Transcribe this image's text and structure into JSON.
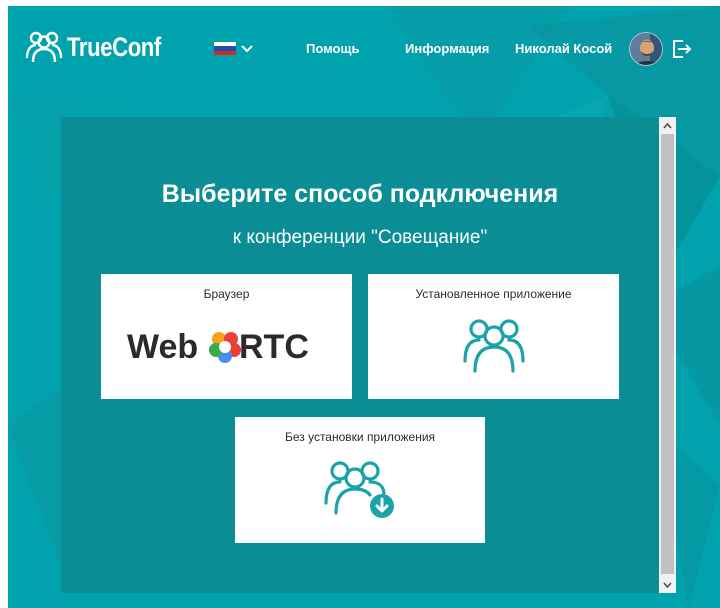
{
  "header": {
    "logo_text": "TrueConf",
    "language": "ru",
    "nav": {
      "help": "Помощь",
      "info": "Информация",
      "user_name": "Николай Косой"
    }
  },
  "main": {
    "title": "Выберите способ подключения",
    "subtitle": "к конференции \"Совещание\"",
    "options": [
      {
        "label": "Браузер",
        "logo_text_left": "Web",
        "logo_text_right": "RTC"
      },
      {
        "label": "Установленное приложение"
      },
      {
        "label": "Без установки приложения"
      }
    ]
  },
  "colors": {
    "background": "#00a3ad",
    "panel": "#0b8d95",
    "accent": "#1aa3a8",
    "card": "#ffffff"
  },
  "icons": [
    "trueconf-logo-icon",
    "russia-flag-icon",
    "chevron-down-icon",
    "avatar",
    "logout-icon",
    "webrtc-logo-icon",
    "people-group-icon",
    "people-group-download-icon"
  ]
}
